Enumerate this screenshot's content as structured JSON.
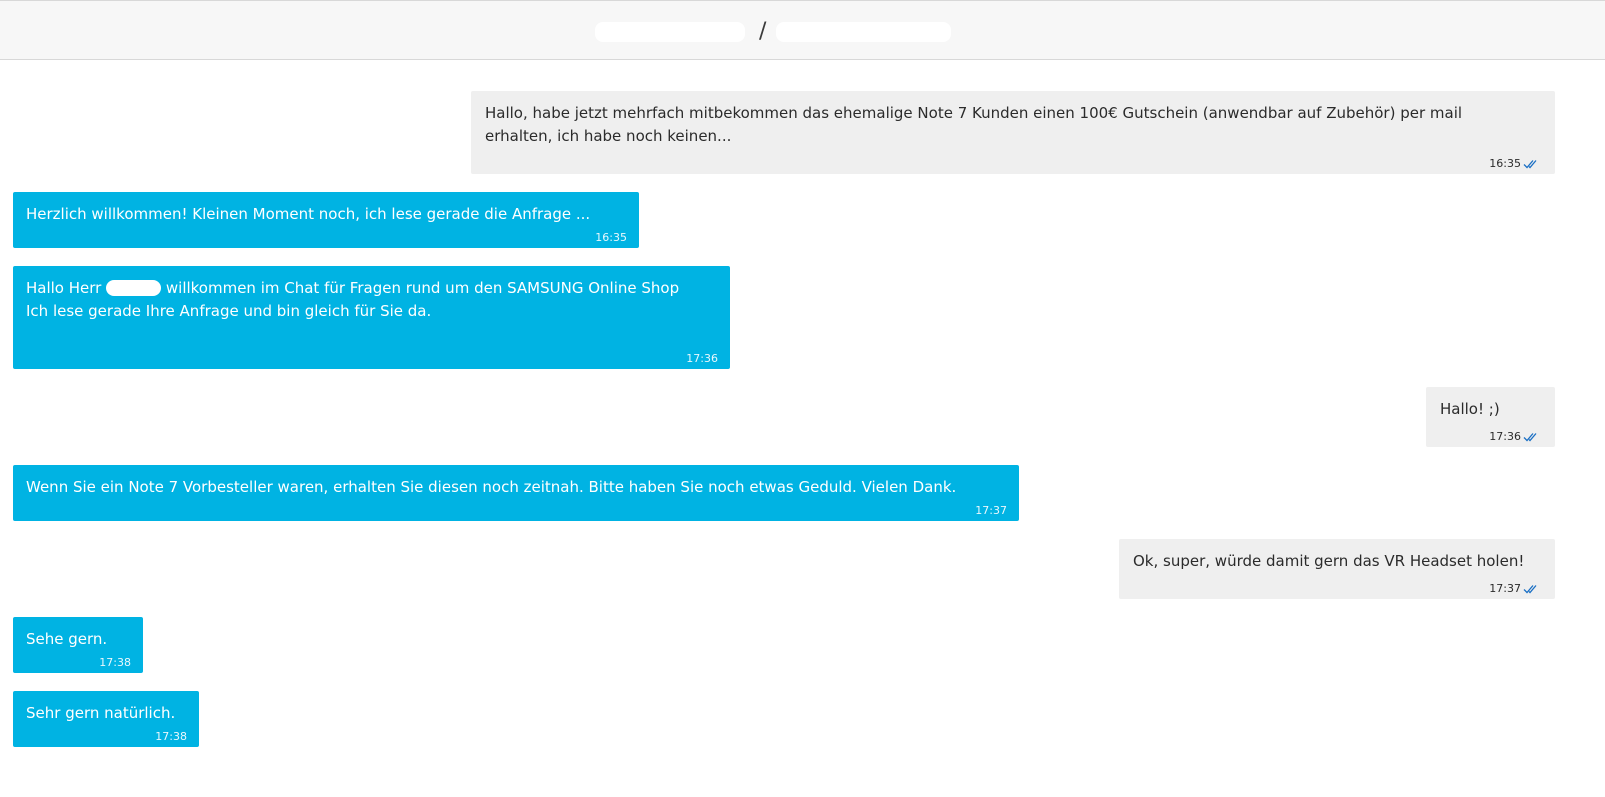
{
  "header": {
    "separator": "/"
  },
  "messages": [
    {
      "direction": "out",
      "text": "Hallo, habe jetzt mehrfach mitbekommen das ehemalige Note 7 Kunden einen 100€ Gutschein (anwendbar auf Zubehör) per mail\nerhalten, ich habe noch keinen...",
      "time": "16:35",
      "read": true
    },
    {
      "direction": "in",
      "text": "Herzlich willkommen! Kleinen Moment noch, ich lese gerade die Anfrage ...",
      "time": "16:35"
    },
    {
      "direction": "in",
      "text_before": "Hallo Herr ",
      "text_after": " willkommen im Chat für Fragen rund um den SAMSUNG Online Shop\nIch lese gerade Ihre Anfrage und bin gleich für Sie da.",
      "time": "17:36"
    },
    {
      "direction": "out",
      "text": "Hallo! ;)",
      "time": "17:36",
      "read": true
    },
    {
      "direction": "in",
      "text": "Wenn Sie ein Note 7 Vorbesteller waren, erhalten Sie diesen noch zeitnah. Bitte haben Sie noch etwas Geduld. Vielen Dank.",
      "time": "17:37"
    },
    {
      "direction": "out",
      "text": "Ok, super, würde damit gern das VR Headset holen!",
      "time": "17:37",
      "read": true
    },
    {
      "direction": "in",
      "text": "Sehe gern.",
      "time": "17:38"
    },
    {
      "direction": "in",
      "text": "Sehr gern natürlich.",
      "time": "17:38"
    }
  ],
  "colors": {
    "incoming_bubble": "#00b3e3",
    "outgoing_bubble": "#efefef",
    "read_ticks": "#1a6fc4"
  },
  "icons": {
    "read_receipt": "double-check-icon"
  }
}
